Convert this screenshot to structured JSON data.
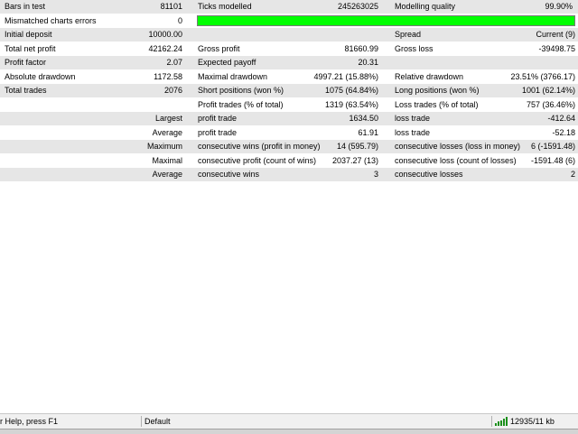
{
  "report": {
    "bars_in_test": {
      "label": "Bars in test",
      "value": "81101"
    },
    "ticks_modelled": {
      "label": "Ticks modelled",
      "value": "245263025"
    },
    "modelling_quality": {
      "label": "Modelling quality",
      "value": "99.90%",
      "fraction": 0.999
    },
    "mismatched_errors": {
      "label": "Mismatched charts errors",
      "value": "0"
    },
    "initial_deposit": {
      "label": "Initial deposit",
      "value": "10000.00"
    },
    "spread": {
      "label": "Spread",
      "value": "Current (9)"
    },
    "total_net_profit": {
      "label": "Total net profit",
      "value": "42162.24"
    },
    "gross_profit": {
      "label": "Gross profit",
      "value": "81660.99"
    },
    "gross_loss": {
      "label": "Gross loss",
      "value": "-39498.75"
    },
    "profit_factor": {
      "label": "Profit factor",
      "value": "2.07"
    },
    "expected_payoff": {
      "label": "Expected payoff",
      "value": "20.31"
    },
    "absolute_drawdown": {
      "label": "Absolute drawdown",
      "value": "1172.58"
    },
    "maximal_drawdown": {
      "label": "Maximal drawdown",
      "value": "4997.21 (15.88%)"
    },
    "relative_drawdown": {
      "label": "Relative drawdown",
      "value": "23.51% (3766.17)"
    },
    "total_trades": {
      "label": "Total trades",
      "value": "2076"
    },
    "short_positions": {
      "label": "Short positions (won %)",
      "value": "1075 (64.84%)"
    },
    "long_positions": {
      "label": "Long positions (won %)",
      "value": "1001 (62.14%)"
    },
    "profit_trades": {
      "label": "Profit trades (% of total)",
      "value": "1319 (63.54%)"
    },
    "loss_trades": {
      "label": "Loss trades (% of total)",
      "value": "757 (36.46%)"
    },
    "largest": {
      "label": "Largest",
      "profit_label": "profit trade",
      "profit_value": "1634.50",
      "loss_label": "loss trade",
      "loss_value": "-412.64"
    },
    "average": {
      "label": "Average",
      "profit_label": "profit trade",
      "profit_value": "61.91",
      "loss_label": "loss trade",
      "loss_value": "-52.18"
    },
    "maximum": {
      "label": "Maximum",
      "profit_label": "consecutive wins (profit in money)",
      "profit_value": "14 (595.79)",
      "loss_label": "consecutive losses (loss in money)",
      "loss_value": "6 (-1591.48)"
    },
    "maximal": {
      "label": "Maximal",
      "profit_label": "consecutive profit (count of wins)",
      "profit_value": "2037.27 (13)",
      "loss_label": "consecutive loss (count of losses)",
      "loss_value": "-1591.48 (6)"
    },
    "average_consec": {
      "label": "Average",
      "profit_label": "consecutive wins",
      "profit_value": "3",
      "loss_label": "consecutive losses",
      "loss_value": "2"
    }
  },
  "statusbar": {
    "help": "r Help, press F1",
    "profile": "Default",
    "traffic": "12935/11 kb",
    "traffic_icon": "connection-bars-icon"
  },
  "colors": {
    "row_shade": "#e6e6e6",
    "quality_bar": "#00ff00",
    "traffic_icon": "#1a8f1a"
  }
}
